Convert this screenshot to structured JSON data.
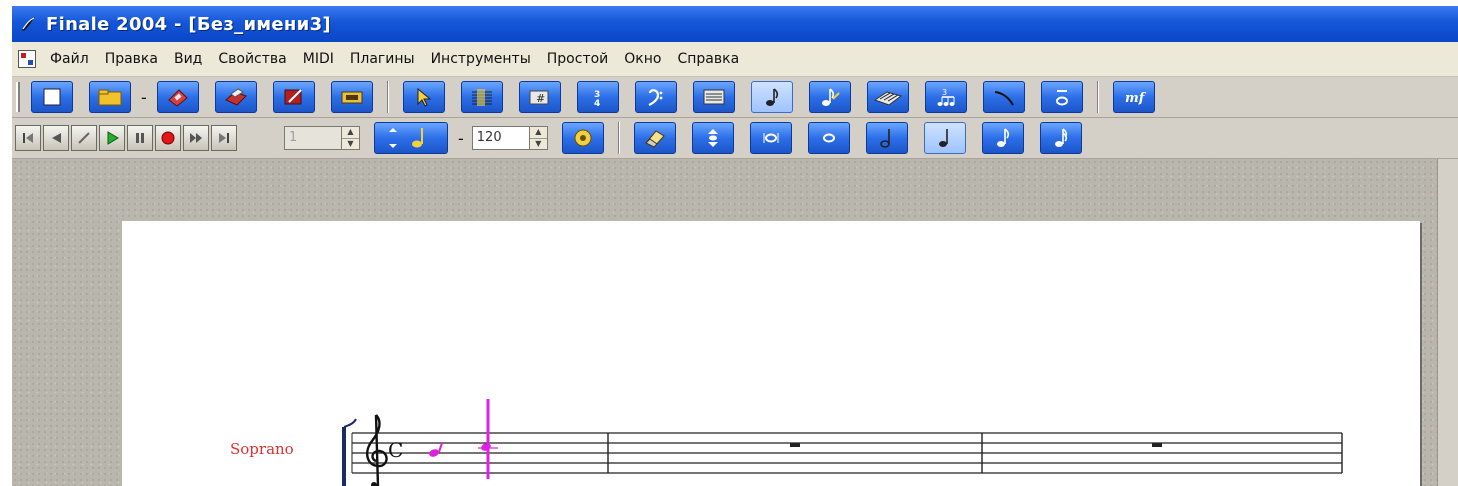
{
  "window": {
    "title": "Finale 2004 - [Без_имени3]"
  },
  "menu": {
    "items": [
      "Файл",
      "Правка",
      "Вид",
      "Свойства",
      "MIDI",
      "Плагины",
      "Инструменты",
      "Простой",
      "Окно",
      "Справка"
    ]
  },
  "toolbar1": {
    "dash": "-",
    "icons": [
      "new-document-icon",
      "open-folder-icon",
      "save-disk-icon",
      "print-icon",
      "staff-edit-icon",
      "measure-tool-icon",
      "selection-arrow-icon",
      "staff-tool-icon",
      "key-signature-icon",
      "time-signature-icon",
      "clef-icon",
      "page-layout-icon",
      "simple-entry-icon",
      "speedy-entry-icon",
      "hyperscribe-icon",
      "tuplet-icon",
      "smart-shape-icon",
      "articulation-icon",
      "expression-icon"
    ]
  },
  "toolbar2": {
    "measure_field": "1",
    "tempo_dash": "-",
    "tempo_value": "120",
    "icons": [
      "playback-settings-icon",
      "eraser-icon",
      "stepper-icon",
      "breve-icon",
      "whole-note-icon",
      "half-note-icon",
      "quarter-note-icon",
      "eighth-note-icon",
      "sixteenth-note-icon"
    ]
  },
  "score": {
    "staff_name": "Soprano",
    "time_signature": "C",
    "note_color": "#e020e0",
    "label_color": "#e03030"
  }
}
